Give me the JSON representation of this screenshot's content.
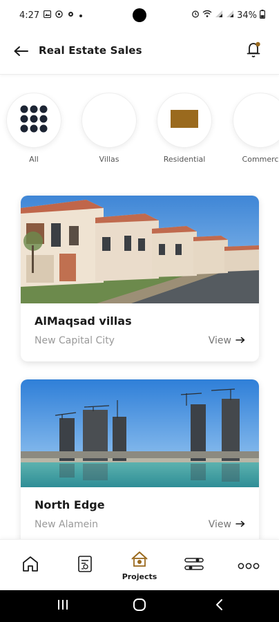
{
  "status_bar": {
    "time": "4:27",
    "left_icons": [
      "gallery-icon",
      "whatsapp-icon",
      "settings-icon",
      "dot-icon"
    ],
    "right_icons": [
      "alarm-icon",
      "wifi-icon",
      "signal-icon",
      "signal-icon-2"
    ],
    "battery": "34%"
  },
  "header": {
    "title": "Real Estate Sales",
    "back_icon": "arrow-left-icon",
    "notification_icon": "bell-icon"
  },
  "categories": [
    {
      "label": "All",
      "icon": "grid-dots-icon"
    },
    {
      "label": "Villas",
      "icon": ""
    },
    {
      "label": "Residential",
      "icon": "brown-rectangle"
    },
    {
      "label": "Commerc",
      "icon": ""
    }
  ],
  "projects": [
    {
      "name": "AlMaqsad villas",
      "location": "New Capital City",
      "view_label": "View"
    },
    {
      "name": "North Edge",
      "location": "New Alamein",
      "view_label": "View"
    }
  ],
  "bottom_nav": {
    "items": [
      {
        "name": "home",
        "label": ""
      },
      {
        "name": "contracts",
        "label": ""
      },
      {
        "name": "projects",
        "label": "Projects"
      },
      {
        "name": "filters",
        "label": ""
      },
      {
        "name": "more",
        "label": ""
      }
    ]
  },
  "colors": {
    "accent_brown": "#9a6a1e",
    "dark_navy": "#1c2433",
    "text_dark": "#1b1b1b",
    "text_muted": "#9a9a9a"
  }
}
